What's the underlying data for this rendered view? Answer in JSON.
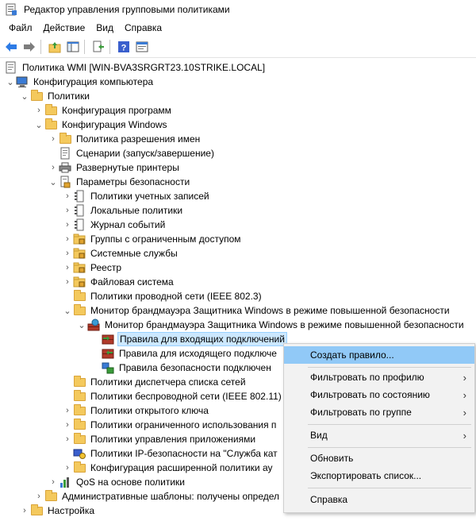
{
  "window": {
    "title": "Редактор управления групповыми политиками"
  },
  "menubar": {
    "items": [
      "Файл",
      "Действие",
      "Вид",
      "Справка"
    ]
  },
  "toolbar": {
    "buttons": [
      "back-icon",
      "forward-icon",
      "folder-up-icon",
      "show-hide-tree-icon",
      "export-list-icon",
      "help-icon",
      "properties-icon"
    ]
  },
  "tree": {
    "items": [
      {
        "label": "Политика WMI [WIN-BVA3SRGRT23.10STRIKE.LOCAL]",
        "icon": "policy-doc-icon"
      },
      {
        "label": "Конфигурация компьютера",
        "icon": "computer-icon"
      },
      {
        "label": "Политики",
        "icon": "folder-icon"
      },
      {
        "label": "Конфигурация программ",
        "icon": "folder-icon"
      },
      {
        "label": "Конфигурация Windows",
        "icon": "folder-icon"
      },
      {
        "label": "Политика разрешения имен",
        "icon": "folder-icon"
      },
      {
        "label": "Сценарии (запуск/завершение)",
        "icon": "script-icon"
      },
      {
        "label": "Развернутые принтеры",
        "icon": "printer-icon"
      },
      {
        "label": "Параметры безопасности",
        "icon": "security-settings-icon"
      },
      {
        "label": "Политики учетных записей",
        "icon": "policy-icon"
      },
      {
        "label": "Локальные политики",
        "icon": "policy-icon"
      },
      {
        "label": "Журнал событий",
        "icon": "policy-icon"
      },
      {
        "label": "Группы с ограниченным доступом",
        "icon": "locked-folder-icon"
      },
      {
        "label": "Системные службы",
        "icon": "locked-folder-icon"
      },
      {
        "label": "Реестр",
        "icon": "locked-folder-icon"
      },
      {
        "label": "Файловая система",
        "icon": "locked-folder-icon"
      },
      {
        "label": "Политики проводной сети (IEEE 802.3)",
        "icon": "folder-icon"
      },
      {
        "label": "Монитор брандмауэра Защитника Windows в режиме повышенной безопасности",
        "icon": "folder-icon"
      },
      {
        "label": "Монитор брандмауэра Защитника Windows в режиме повышенной безопасности",
        "icon": "firewall-icon"
      },
      {
        "label": "Правила для входящих подключений",
        "icon": "inbound-rules-icon"
      },
      {
        "label": "Правила для исходящего подключе",
        "icon": "outbound-rules-icon"
      },
      {
        "label": "Правила безопасности подключен",
        "icon": "connection-security-icon"
      },
      {
        "label": "Политики диспетчера списка сетей",
        "icon": "folder-icon"
      },
      {
        "label": "Политики беспроводной сети (IEEE 802.11)",
        "icon": "folder-icon"
      },
      {
        "label": "Политики открытого ключа",
        "icon": "folder-icon"
      },
      {
        "label": "Политики ограниченного использования п",
        "icon": "folder-icon"
      },
      {
        "label": "Политики управления приложениями",
        "icon": "folder-icon"
      },
      {
        "label": "Политики IP-безопасности на \"Служба кат",
        "icon": "ipsec-icon"
      },
      {
        "label": "Конфигурация расширенной политики ау",
        "icon": "folder-icon"
      },
      {
        "label": "QoS на основе политики",
        "icon": "qos-chart-icon"
      },
      {
        "label": "Административные шаблоны: получены определ",
        "icon": "folder-icon"
      },
      {
        "label": "Настройка",
        "icon": "folder-icon"
      }
    ]
  },
  "context_menu": {
    "items": [
      {
        "label": "Создать правило...",
        "submenu": false,
        "highlighted": true
      },
      {
        "label": "Фильтровать по профилю",
        "submenu": true
      },
      {
        "label": "Фильтровать по состоянию",
        "submenu": true
      },
      {
        "label": "Фильтровать по группе",
        "submenu": true
      },
      {
        "label": "Вид",
        "submenu": true
      },
      {
        "label": "Обновить",
        "submenu": false
      },
      {
        "label": "Экспортировать список...",
        "submenu": false
      },
      {
        "label": "Справка",
        "submenu": false
      }
    ],
    "arrow_glyph": "›"
  },
  "colors": {
    "selection": "#cce8ff",
    "menu_highlight": "#91c9f7",
    "menu_bg": "#f2f2f2",
    "folder": "#f4c95d"
  }
}
